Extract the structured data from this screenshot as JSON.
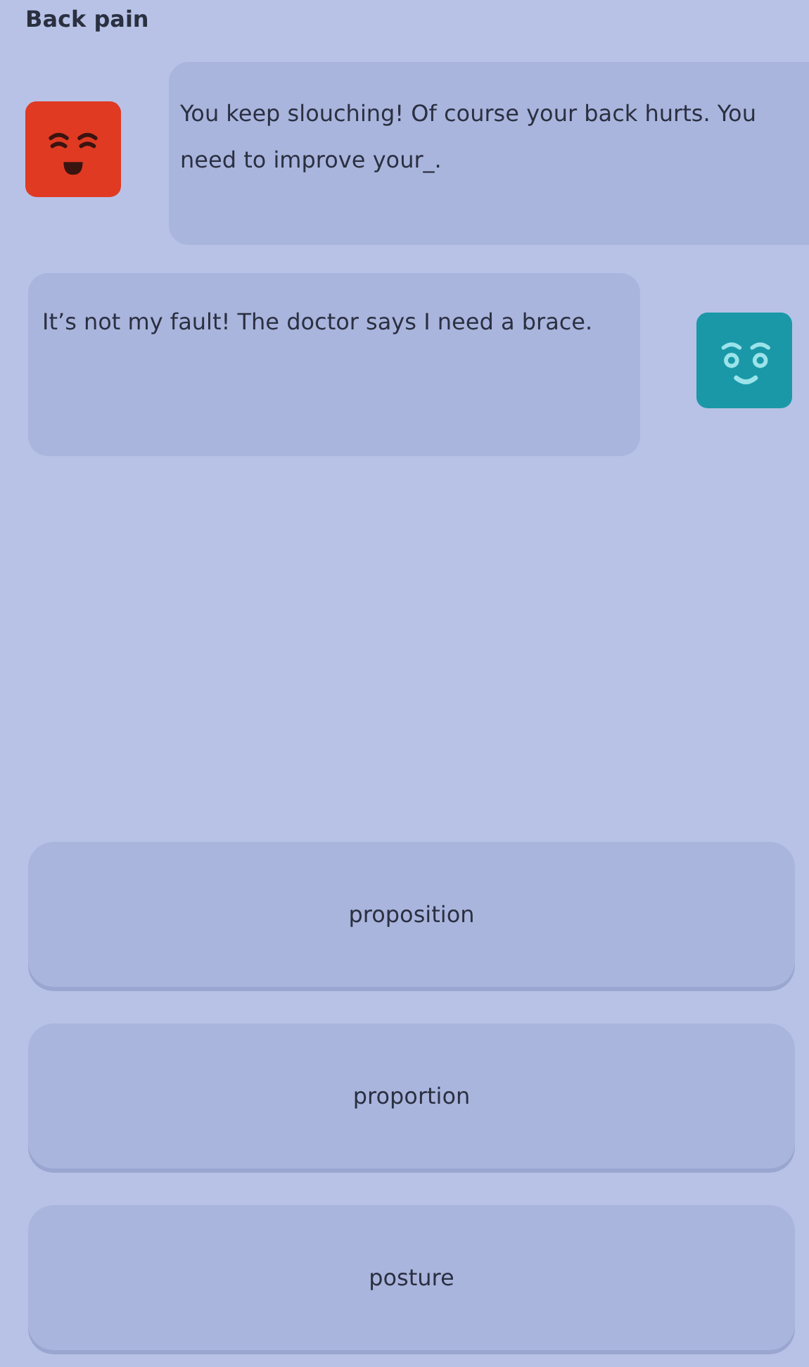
{
  "title": "Back pain",
  "messages": [
    {
      "kind": "left",
      "color": "#e03a22",
      "text": "You keep slouching! Of course your back hurts. You need to improve your_."
    },
    {
      "kind": "right",
      "color": "#1a98a8",
      "text": "It’s not my fault! The doctor says I need a brace."
    }
  ],
  "options": [
    {
      "label": "proposition"
    },
    {
      "label": "proportion"
    },
    {
      "label": "posture"
    }
  ]
}
